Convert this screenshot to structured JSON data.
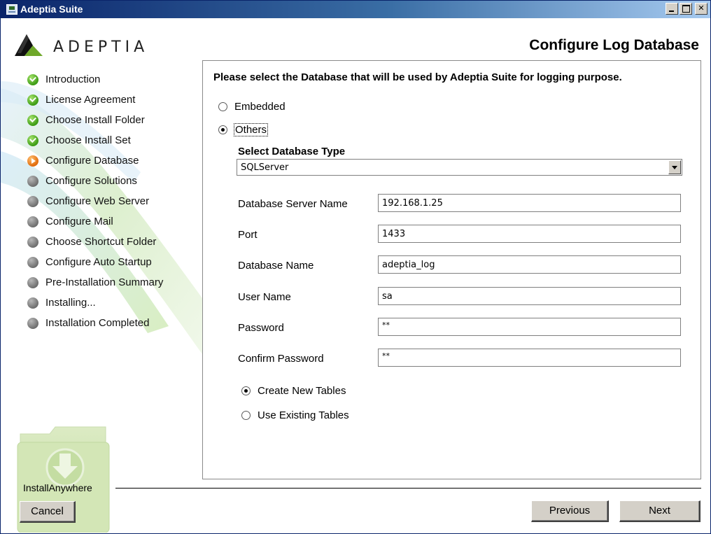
{
  "window": {
    "title": "Adeptia Suite"
  },
  "header": {
    "brand": "ADEPTIA",
    "page_title": "Configure Log Database"
  },
  "steps": [
    {
      "label": "Introduction",
      "status": "done"
    },
    {
      "label": "License Agreement",
      "status": "done"
    },
    {
      "label": "Choose Install Folder",
      "status": "done"
    },
    {
      "label": "Choose Install Set",
      "status": "done"
    },
    {
      "label": "Configure Database",
      "status": "current"
    },
    {
      "label": "Configure Solutions",
      "status": "pending"
    },
    {
      "label": "Configure Web Server",
      "status": "pending"
    },
    {
      "label": "Configure Mail",
      "status": "pending"
    },
    {
      "label": "Choose Shortcut Folder",
      "status": "pending"
    },
    {
      "label": "Configure Auto Startup",
      "status": "pending"
    },
    {
      "label": "Pre-Installation Summary",
      "status": "pending"
    },
    {
      "label": "Installing...",
      "status": "pending"
    },
    {
      "label": "Installation Completed",
      "status": "pending"
    }
  ],
  "content": {
    "prompt": "Please select the Database that will be used by Adeptia Suite for logging purpose.",
    "db_mode": {
      "embedded": {
        "label": "Embedded",
        "selected": false
      },
      "others": {
        "label": "Others",
        "selected": true
      }
    },
    "db_type": {
      "label": "Select Database Type",
      "value": "SQLServer"
    },
    "fields": {
      "server_name": {
        "label": "Database Server Name",
        "value": "192.168.1.25"
      },
      "port": {
        "label": "Port",
        "value": "1433"
      },
      "db_name": {
        "label": "Database Name",
        "value": "adeptia_log"
      },
      "user_name": {
        "label": "User Name",
        "value": "sa"
      },
      "password": {
        "label": "Password",
        "value": "**"
      },
      "confirm_password": {
        "label": "Confirm Password",
        "value": "**"
      }
    },
    "tables": {
      "create_new": {
        "label": "Create New Tables",
        "selected": true
      },
      "use_existing": {
        "label": "Use Existing Tables",
        "selected": false
      }
    }
  },
  "footer": {
    "brand": "InstallAnywhere",
    "cancel_label": "Cancel",
    "previous_label": "Previous",
    "next_label": "Next"
  },
  "colors": {
    "titlebar_start": "#0a246a",
    "titlebar_end": "#a6caf0",
    "step_done": "#3c9b14",
    "step_current": "#e06a0a",
    "step_pending": "#6a6a6a",
    "button_face": "#d4d0c8"
  }
}
